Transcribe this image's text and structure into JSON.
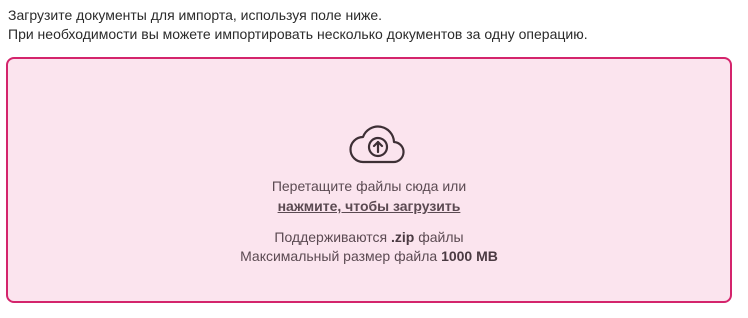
{
  "intro": {
    "line1": "Загрузите документы для импорта, используя поле ниже.",
    "line2": "При необходимости вы можете импортировать несколько документов за одну операцию."
  },
  "dropzone": {
    "icon": "cloud-upload-icon",
    "drag_text": "Перетащите файлы сюда или",
    "click_text": "нажмите, чтобы загрузить",
    "formats_prefix": "Поддерживаются",
    "formats_value": ".zip",
    "formats_suffix": "файлы",
    "maxsize_prefix": "Максимальный размер файла",
    "maxsize_value": "1000 MB"
  },
  "colors": {
    "border": "#d4246c",
    "background": "#fbe4ee",
    "text": "#5b4a52"
  }
}
